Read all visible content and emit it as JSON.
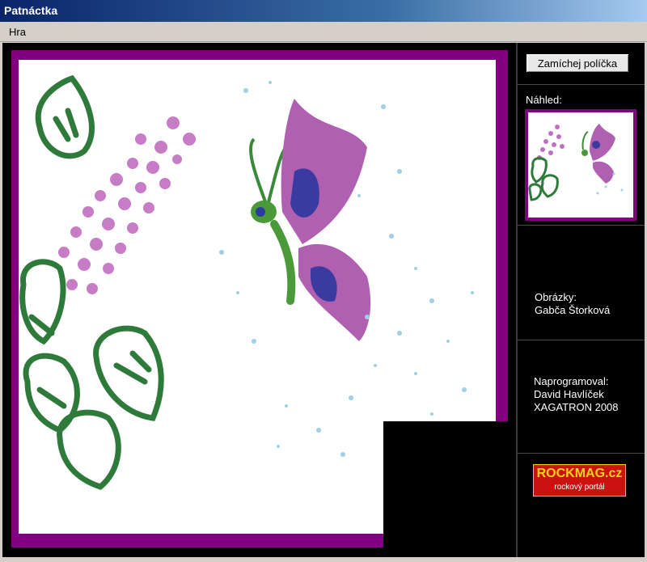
{
  "window": {
    "title": "Patnáctka"
  },
  "menu": {
    "items": [
      "Hra"
    ]
  },
  "controls": {
    "shuffle_label": "Zamíchej políčka"
  },
  "preview": {
    "label": "Náhled:"
  },
  "credits": {
    "images_label": "Obrázky:",
    "images_author": "Gabča Štorková",
    "programmed_label": "Naprogramoval:",
    "programmer": "David Havlíček",
    "studio": "XAGATRON 2008"
  },
  "logo": {
    "name": "ROCKMAG.cz",
    "tagline": "rockový portál"
  },
  "colors": {
    "frame": "#800080",
    "background": "#000000",
    "logo_bg": "#cc1111",
    "logo_text": "#ffd21a"
  },
  "icons": {
    "picture": "butterfly-and-lilac-painting"
  }
}
